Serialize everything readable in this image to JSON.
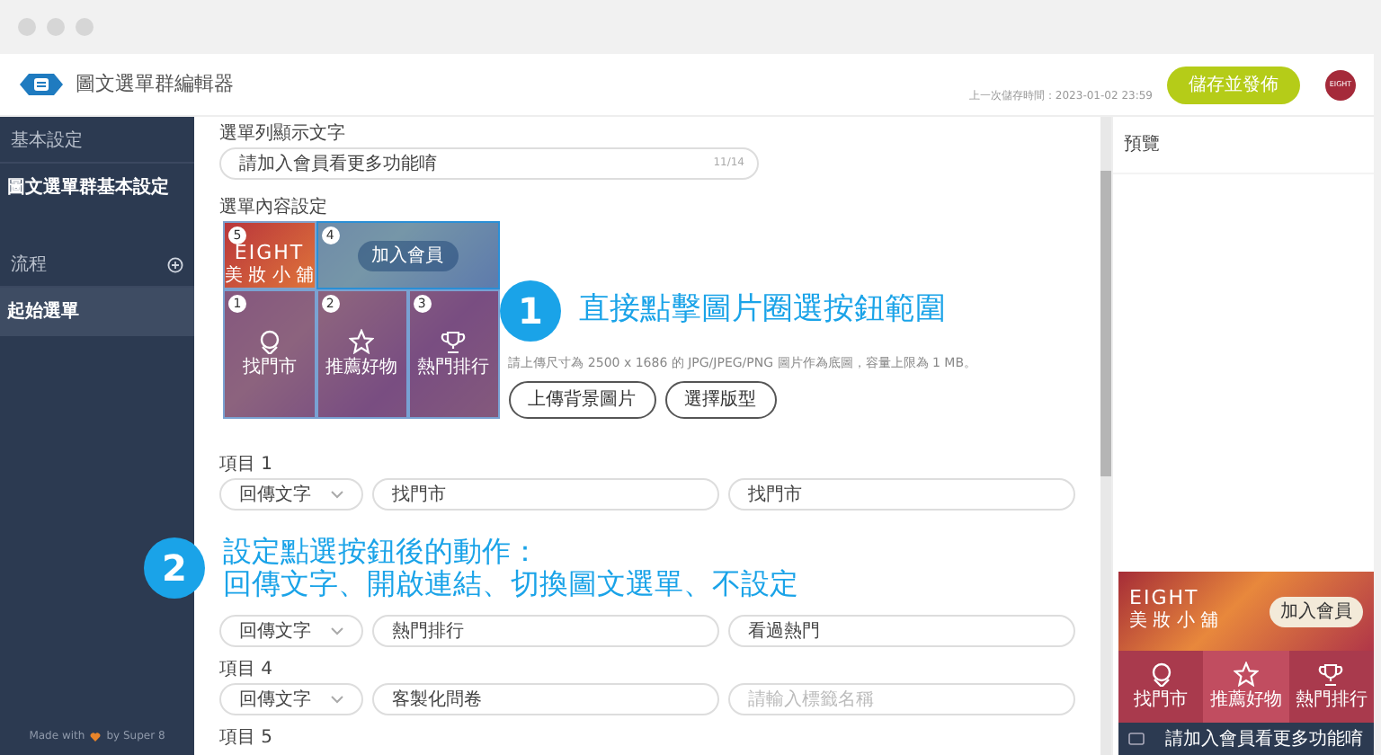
{
  "header": {
    "title": "圖文選單群編輯器",
    "last_saved": "上一次儲存時間：2023-01-02 23:59",
    "publish_button": "儲存並發佈",
    "avatar": "EIGHT"
  },
  "sidebar": {
    "sections": [
      {
        "heading": "基本設定",
        "add_button": false,
        "items": [
          {
            "label": "圖文選單群基本設定",
            "selected": false
          }
        ]
      },
      {
        "heading": "流程",
        "add_button": true,
        "items": [
          {
            "label": "起始選單",
            "selected": true
          }
        ]
      }
    ],
    "footer": {
      "before": "Made with",
      "after": "by Super 8"
    }
  },
  "editor": {
    "menu_text": {
      "label": "選單列顯示文字",
      "value": "請加入會員看更多功能唷",
      "counter": "11/14"
    },
    "content_label": "選單內容設定",
    "image": {
      "brand": "EIGHT",
      "subtitle": "美 妝 小 舖",
      "join_button": "加入會員",
      "areas": [
        {
          "number": "5",
          "selected": false
        },
        {
          "number": "4",
          "selected": true
        },
        {
          "number": "1",
          "label": "找門市",
          "selected": false
        },
        {
          "number": "2",
          "label": "推薦好物",
          "selected": false
        },
        {
          "number": "3",
          "label": "熱門排行",
          "selected": false
        }
      ]
    },
    "hint": "請上傳尺寸為 2500 x 1686 的 JPG/JPEG/PNG 圖片作為底圖，容量上限為 1 MB。",
    "upload_button": "上傳背景圖片",
    "template_button": "選擇版型",
    "items": [
      {
        "label": "項目 1",
        "action": "回傳文字",
        "text": "找門市",
        "tag": "找門市"
      },
      {
        "action": "回傳文字",
        "text": "熱門排行",
        "tag": "看過熱門"
      },
      {
        "label": "項目 4",
        "action": "回傳文字",
        "text": "客製化問卷",
        "tag_placeholder": "請輸入標籤名稱"
      },
      {
        "label": "項目 5"
      }
    ]
  },
  "preview": {
    "title": "預覽",
    "brand": "EIGHT",
    "subtitle": "美 妝 小 舖",
    "join_button": "加入會員",
    "items": [
      {
        "label": "找門市",
        "selected": false
      },
      {
        "label": "推薦好物",
        "selected": true
      },
      {
        "label": "熱門排行",
        "selected": false
      }
    ],
    "chat_bar": "請加入會員看更多功能唷"
  },
  "annotations": [
    {
      "number": "1",
      "lines": [
        "直接點擊圖片圈選按鈕範圍"
      ]
    },
    {
      "number": "2",
      "lines": [
        "設定點選按鈕後的動作：",
        "回傳文字、開啟連結、切換圖文選單、不設定"
      ]
    }
  ]
}
